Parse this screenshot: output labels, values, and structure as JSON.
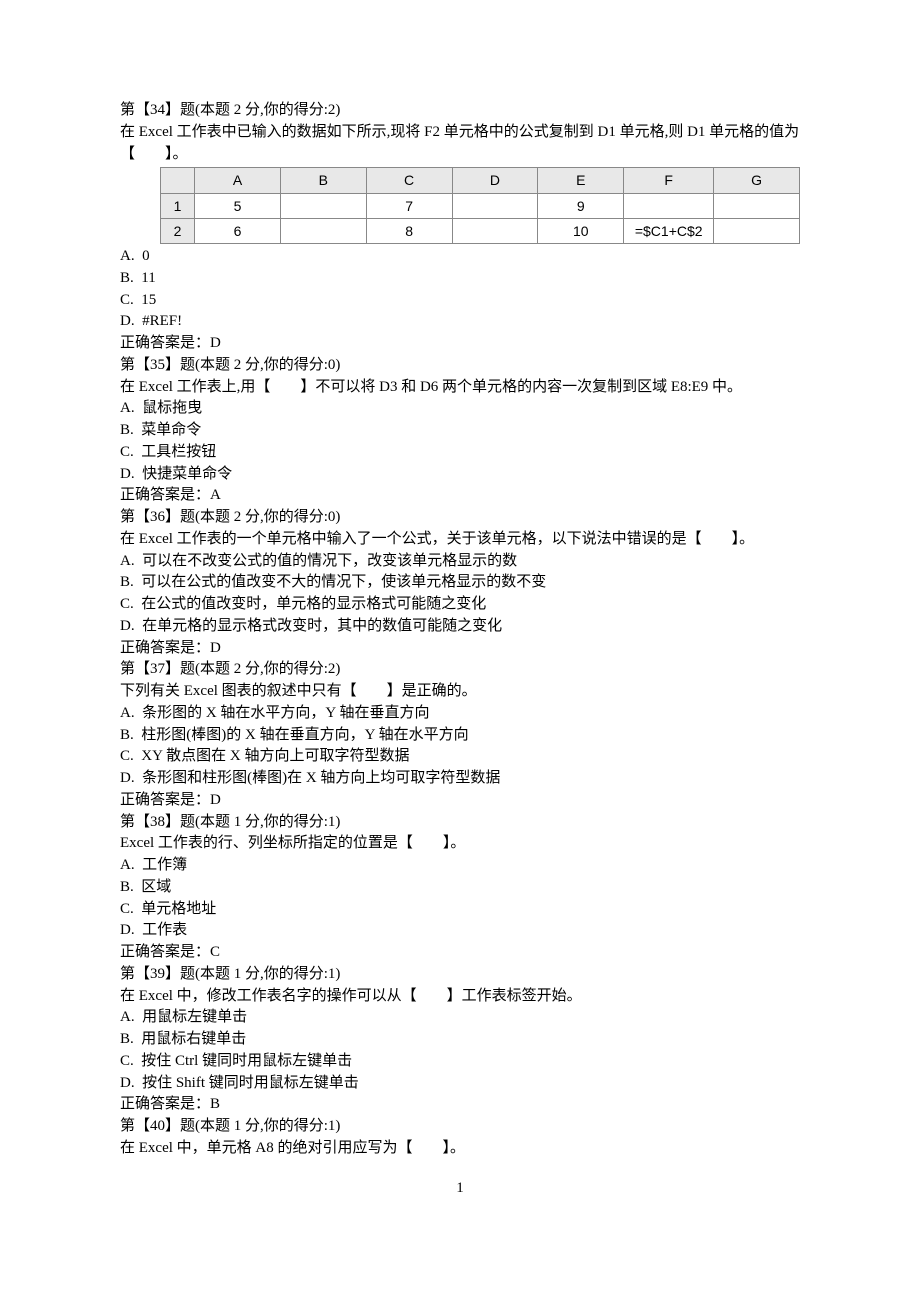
{
  "page_number": "1",
  "q34": {
    "title": "第【34】题(本题 2 分,你的得分:2)",
    "text": "在 Excel 工作表中已输入的数据如下所示,现将 F2 单元格中的公式复制到 D1 单元格,则 D1 单元格的值为【　　】。",
    "optA": "A.  0",
    "optB": "B.  11",
    "optC": "C.  15",
    "optD": "D.  #REF!",
    "answer": "正确答案是：D",
    "table": {
      "headers": [
        "",
        "A",
        "B",
        "C",
        "D",
        "E",
        "F",
        "G"
      ],
      "rows": [
        [
          "1",
          "5",
          "",
          "7",
          "",
          "9",
          "",
          ""
        ],
        [
          "2",
          "6",
          "",
          "8",
          "",
          "10",
          "=$C1+C$2",
          ""
        ]
      ]
    }
  },
  "q35": {
    "title": "第【35】题(本题 2 分,你的得分:0)",
    "text": "在 Excel 工作表上,用【　　】不可以将 D3 和 D6 两个单元格的内容一次复制到区域 E8:E9 中。",
    "optA": "A.  鼠标拖曳",
    "optB": "B.  菜单命令",
    "optC": "C.  工具栏按钮",
    "optD": "D.  快捷菜单命令",
    "answer": "正确答案是：A"
  },
  "q36": {
    "title": "第【36】题(本题 2 分,你的得分:0)",
    "text": "在 Excel 工作表的一个单元格中输入了一个公式，关于该单元格，以下说法中错误的是【　　】。",
    "optA": "A.  可以在不改变公式的值的情况下，改变该单元格显示的数",
    "optB": "B.  可以在公式的值改变不大的情况下，使该单元格显示的数不变",
    "optC": "C.  在公式的值改变时，单元格的显示格式可能随之变化",
    "optD": "D.  在单元格的显示格式改变时，其中的数值可能随之变化",
    "answer": "正确答案是：D"
  },
  "q37": {
    "title": "第【37】题(本题 2 分,你的得分:2)",
    "text": "下列有关 Excel 图表的叙述中只有【　　】是正确的。",
    "optA": "A.  条形图的 X 轴在水平方向，Y 轴在垂直方向",
    "optB": "B.  柱形图(棒图)的 X 轴在垂直方向，Y 轴在水平方向",
    "optC": "C.  XY 散点图在 X 轴方向上可取字符型数据",
    "optD": "D.  条形图和柱形图(棒图)在 X 轴方向上均可取字符型数据",
    "answer": "正确答案是：D"
  },
  "q38": {
    "title": "第【38】题(本题 1 分,你的得分:1)",
    "text": "Excel 工作表的行、列坐标所指定的位置是【　　】。",
    "optA": "A.  工作簿",
    "optB": "B.  区域",
    "optC": "C.  单元格地址",
    "optD": "D.  工作表",
    "answer": "正确答案是：C"
  },
  "q39": {
    "title": "第【39】题(本题 1 分,你的得分:1)",
    "text": "在 Excel 中，修改工作表名字的操作可以从【　　】工作表标签开始。",
    "optA": "A.  用鼠标左键单击",
    "optB": "B.  用鼠标右键单击",
    "optC": "C.  按住 Ctrl 键同时用鼠标左键单击",
    "optD": "D.  按住 Shift 键同时用鼠标左键单击",
    "answer": "正确答案是：B"
  },
  "q40": {
    "title": "第【40】题(本题 1 分,你的得分:1)",
    "text": "在 Excel 中，单元格 A8 的绝对引用应写为【　　】。"
  }
}
